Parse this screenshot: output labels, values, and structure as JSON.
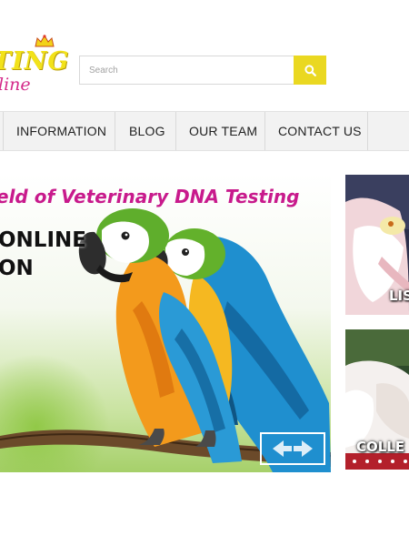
{
  "logo": {
    "main_text": "TING",
    "sub_text": "line"
  },
  "search": {
    "placeholder": "Search",
    "button_icon": "search-icon"
  },
  "nav": {
    "items": [
      {
        "label": "INFORMATION"
      },
      {
        "label": "BLOG"
      },
      {
        "label": "OUR TEAM"
      },
      {
        "label": "CONTACT US"
      }
    ]
  },
  "hero": {
    "caption": "eld of Veterinary DNA Testing",
    "headline_line1": "ONLINE",
    "headline_line2": "ON",
    "image": "macaw-parrots-illustration"
  },
  "side_panels": [
    {
      "label": "LIS",
      "image": "hand-holding-pet-illustration"
    },
    {
      "label": "COLLE",
      "image": "hands-collecting-sample-illustration"
    }
  ],
  "colors": {
    "accent_yellow": "#ead821",
    "brand_pink": "#c81a8c",
    "nav_background": "#f2f2f2"
  }
}
